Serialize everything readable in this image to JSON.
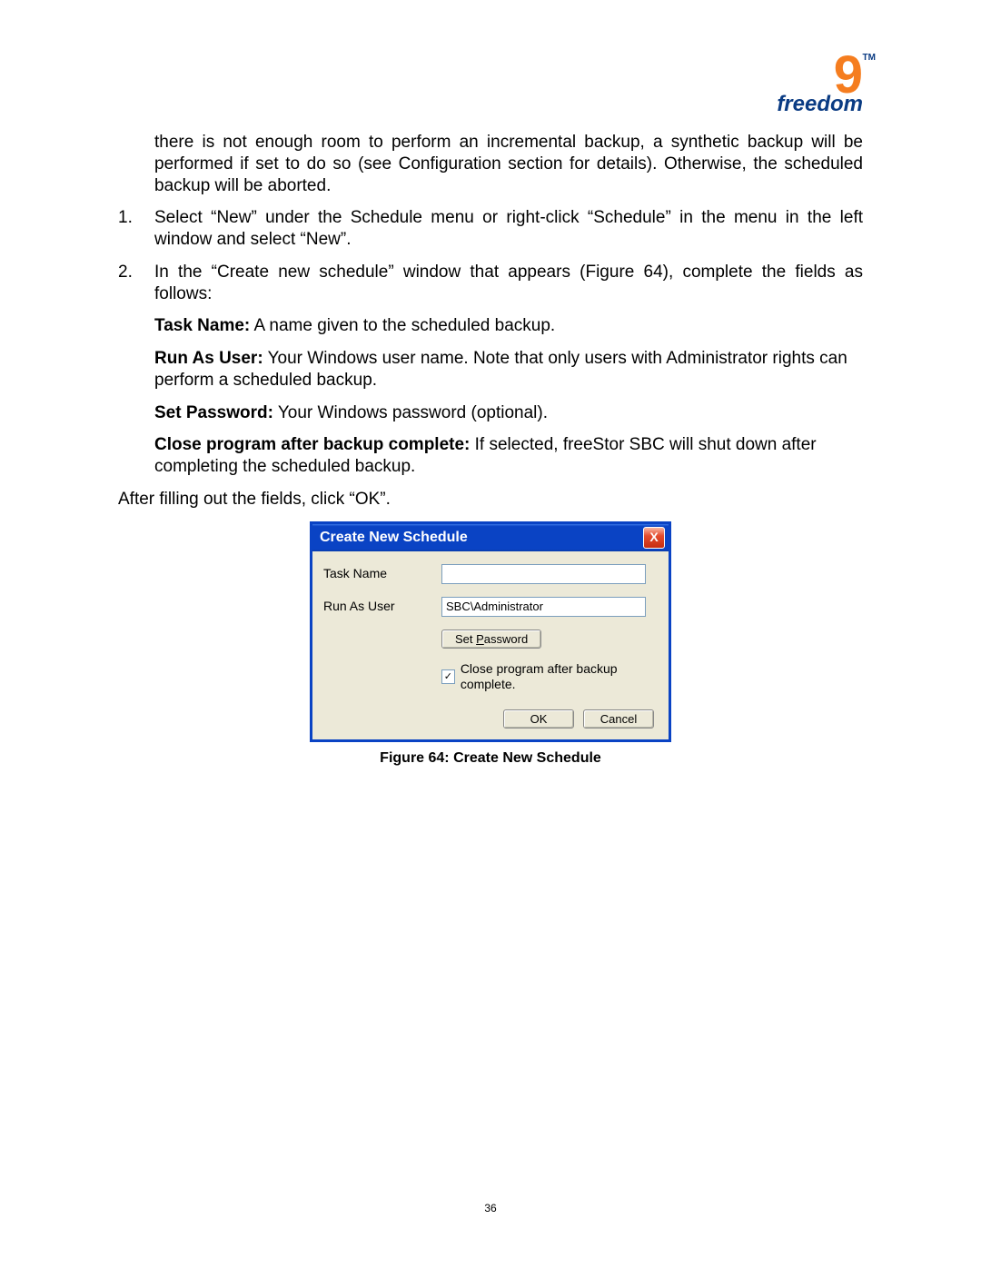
{
  "logo": {
    "word": "freedom",
    "nine": "9",
    "tm": "TM"
  },
  "intro_para": "there is not enough room to perform an incremental backup, a synthetic backup will be performed if set to do so (see Configuration section for details). Otherwise, the scheduled backup will be aborted.",
  "step1_num": "1.",
  "step1": "Select “New” under the Schedule menu or right-click “Schedule” in the menu in the left window and select “New”.",
  "step2_num": "2.",
  "step2": "In the “Create new schedule” window that appears (Figure 64), complete the fields as follows:",
  "def_task_label": "Task Name:",
  "def_task_text": " A name given to the scheduled backup.",
  "def_user_label": "Run As User:",
  "def_user_text": " Your Windows user name.  Note that only users with Administrator rights can perform a scheduled backup.",
  "def_pass_label": "Set Password:",
  "def_pass_text": " Your Windows password (optional).",
  "def_close_label": "Close program after backup complete:",
  "def_close_text": " If selected, freeStor SBC will shut down after completing the scheduled backup.",
  "after_text": "After filling out the fields, click “OK”.",
  "dialog": {
    "title": "Create New Schedule",
    "close_glyph": "X",
    "task_label": "Task Name",
    "task_value": "",
    "user_label": "Run As User",
    "user_value": "SBC\\Administrator",
    "setpw_prefix": "Set ",
    "setpw_u": "P",
    "setpw_suffix": "assword",
    "check_checked": true,
    "check_mark": "✓",
    "check_text": "Close program after backup complete.",
    "ok": "OK",
    "cancel": "Cancel"
  },
  "caption": "Figure 64: Create New Schedule",
  "page_number": "36"
}
